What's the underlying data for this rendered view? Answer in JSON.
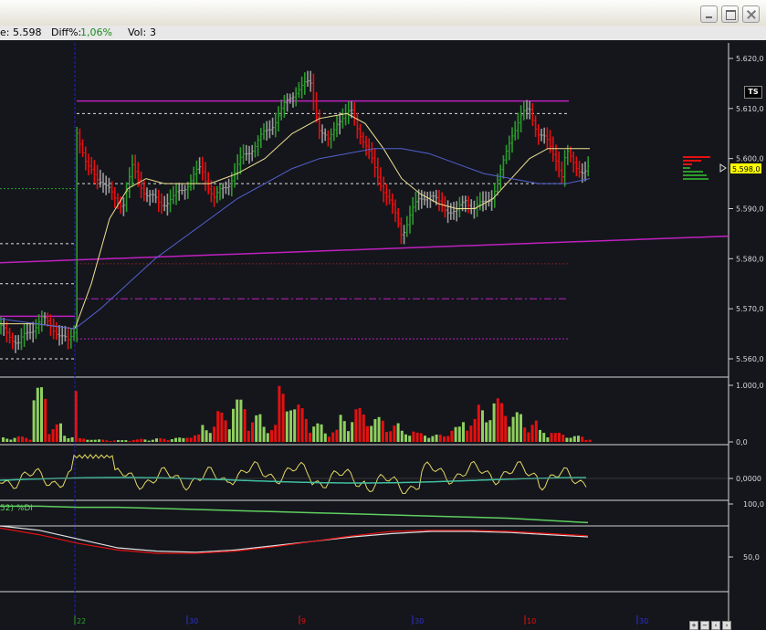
{
  "window": {
    "minimize_label": "minimize",
    "maximize_label": "maximize",
    "close_label": "close"
  },
  "infobar": {
    "last_label": "e:",
    "last_value": "5.598",
    "diff_label": "Diff%:",
    "diff_value": "1,06%",
    "vol_label": "Vol:",
    "vol_value": "3"
  },
  "ts_badge": "TS",
  "colors": {
    "up": "#2b9a2b",
    "down": "#e51010",
    "neutral": "#9a9a9a",
    "ma_fast": "#f0e090",
    "ma_slow": "#5560d0",
    "magenta": "#c020c0",
    "grid": "#d0d0d0",
    "price_tag_bg": "#ffff00"
  },
  "chart_data": [
    {
      "type": "ohlc",
      "panel": "price",
      "price_labels": [
        "5.620,0",
        "5.610,0",
        "5.600,0",
        "5.590,0",
        "5.580,0",
        "5.570,0",
        "5.560,0"
      ],
      "ylim": [
        5556,
        5622
      ],
      "last_price_tag": "5.598,0",
      "x_tick_labels": [
        "22",
        "30",
        "9",
        "30",
        "10",
        "30"
      ],
      "resistance": 5611.5,
      "support": 5580.5,
      "levels": [
        5609,
        5595,
        5579,
        5572,
        5564
      ],
      "series": [
        {
          "name": "",
          "kind": "candles",
          "values_ohlc_approx": [
            [
              5566,
              5569,
              5563,
              5566
            ],
            [
              5566,
              5608,
              5565,
              5604
            ],
            [
              5604,
              5606,
              5594,
              5598
            ],
            [
              5597,
              5602,
              5591,
              5594
            ],
            [
              5593,
              5599,
              5590,
              5596
            ],
            [
              5596,
              5605,
              5593,
              5603
            ],
            [
              5602,
              5610,
              5600,
              5608
            ],
            [
              5608,
              5618,
              5605,
              5614
            ],
            [
              5614,
              5616,
              5603,
              5606
            ],
            [
              5606,
              5612,
              5603,
              5609
            ],
            [
              5609,
              5610,
              5598,
              5600
            ],
            [
              5600,
              5602,
              5586,
              5589
            ],
            [
              5589,
              5593,
              5584,
              5591
            ],
            [
              5591,
              5596,
              5588,
              5593
            ],
            [
              5593,
              5595,
              5590,
              5592
            ],
            [
              5592,
              5597,
              5590,
              5595
            ],
            [
              5595,
              5599,
              5592,
              5597
            ],
            [
              5597,
              5611,
              5595,
              5609
            ],
            [
              5609,
              5612,
              5599,
              5601
            ],
            [
              5601,
              5602,
              5595,
              5598
            ]
          ]
        },
        {
          "name": "",
          "kind": "ma_fast"
        },
        {
          "name": "",
          "kind": "ma_slow"
        }
      ]
    },
    {
      "type": "bar",
      "panel": "volume",
      "ylim": [
        0,
        1000
      ],
      "tick_labels": [
        "1.000,0",
        "0,0"
      ],
      "values_approx": [
        80,
        90,
        900,
        300,
        120,
        60,
        40,
        30,
        40,
        50,
        60,
        70,
        120,
        300,
        500,
        700,
        450,
        300,
        900,
        600,
        300,
        200,
        450,
        550,
        400,
        300,
        200,
        150,
        120,
        250,
        400,
        600,
        700,
        480,
        350,
        200,
        150,
        100,
        60,
        40
      ]
    },
    {
      "type": "line",
      "panel": "oscillator",
      "tick_labels": [
        "0,0000"
      ],
      "values_approx": [
        0.1,
        0.1,
        0.1,
        0.7,
        0.7,
        0.6,
        -0.2,
        -0.1,
        -0.15,
        -0.1,
        0.1,
        0.2,
        0.15,
        0.2,
        0.1,
        0.05,
        -0.15,
        -0.1,
        0.0,
        -0.2,
        -0.1,
        0.15,
        0.2,
        0.1,
        0.15,
        0.2,
        -0.1,
        -0.15
      ]
    },
    {
      "type": "line",
      "panel": "dmi",
      "label": "52) %DI",
      "ylim": [
        0,
        100
      ],
      "tick_labels": [
        "100,0",
        "50,0"
      ],
      "series": [
        {
          "name": "",
          "color": "#5fcf5f",
          "values_approx": [
            98,
            98,
            97,
            97,
            96,
            95,
            94,
            93,
            92,
            91,
            90,
            89,
            88,
            87,
            85,
            83
          ]
        },
        {
          "name": "",
          "color": "#e0e0e0",
          "values_approx": [
            80,
            76,
            68,
            60,
            57,
            56,
            58,
            62,
            66,
            70,
            73,
            75,
            75,
            74,
            72,
            70
          ]
        },
        {
          "name": "",
          "color": "#e51010",
          "values_approx": [
            78,
            72,
            64,
            58,
            55,
            55,
            57,
            61,
            66,
            71,
            75,
            76,
            76,
            75,
            73,
            71
          ]
        }
      ]
    }
  ]
}
